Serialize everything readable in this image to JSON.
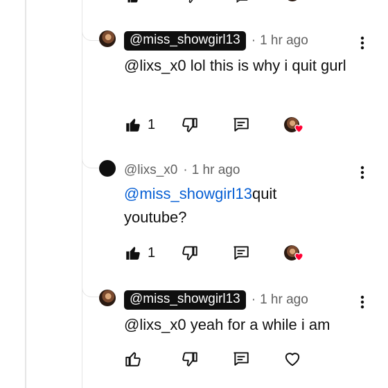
{
  "comments": [
    {
      "author": "@miss_showgirl13",
      "time": "1 hr ago",
      "text": "@lixs_x0 lol this is why i quit gurl",
      "likes": "1",
      "creator_hearted": true
    },
    {
      "author": "@lixs_x0",
      "time": "1 hr ago",
      "mention": "@miss_showgirl13",
      "text": "quit youtube?",
      "likes": "1",
      "creator_hearted": true
    },
    {
      "author": "@miss_showgirl13",
      "time": "1 hr ago",
      "text": "@lixs_x0 yeah for a while i am",
      "likes": "",
      "creator_hearted": false
    }
  ],
  "separator": "·",
  "colors": {
    "mention": "#065fd4",
    "heart": "#ff0033",
    "meta": "#606060"
  }
}
